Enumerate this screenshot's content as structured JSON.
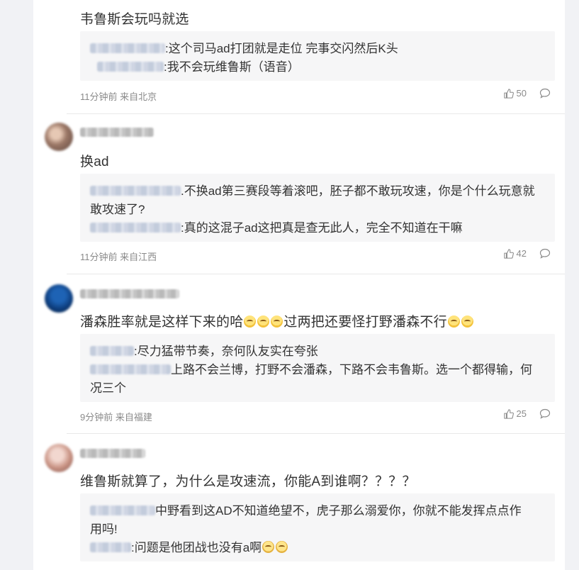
{
  "comments": [
    {
      "text": "韦鲁斯会玩吗就选",
      "replies": [
        {
          "suffix": ":这个司马ad打团就是走位 完事交闪然后K头"
        },
        {
          "suffix": ":我不会玩维鲁斯（语音）"
        }
      ],
      "time": "11分钟前 来自北京",
      "likes": "50"
    },
    {
      "text": "换ad",
      "replies": [
        {
          "suffix": ".不换ad第三赛段等着滚吧，胚子都不敢玩攻速，你是个什么玩意就",
          "suffix2": "敢攻速了?"
        },
        {
          "suffix": ":真的这混子ad这把真是查无此人，完全不知道在干嘛"
        }
      ],
      "time": "11分钟前 来自江西",
      "likes": "42"
    },
    {
      "text_a": "潘森胜率就是这样下来的哈",
      "text_b": "过两把还要怪打野潘森不行",
      "replies": [
        {
          "suffix": ":尽力猛带节奏，奈何队友实在夸张"
        },
        {
          "suffix": "上路不会兰博，打野不会潘森，下路不会韦鲁斯。选一个都得输，何",
          "suffix2": "况三个"
        }
      ],
      "time": "9分钟前 来自福建",
      "likes": "25"
    },
    {
      "text": "维鲁斯就算了，为什么是攻速流，你能A到谁啊？？？？",
      "replies": [
        {
          "suffix": "中野看到这AD不知道绝望不，虎子那么溺爱你，你就不能发挥点点作",
          "suffix2": "用吗!"
        },
        {
          "suffix": ":问题是他团战也没有a啊"
        }
      ]
    }
  ],
  "icons": {
    "like": "thumbs-up-icon",
    "reply": "comment-bubble-icon",
    "emoji_smile": "smiling-emoji-icon",
    "emoji_dog": "dog-face-emoji-icon"
  },
  "colors": {
    "page_bg": "#f1f2f5",
    "reply_bg": "#f6f6f7",
    "meta": "#8a8a8a",
    "text": "#333333"
  }
}
